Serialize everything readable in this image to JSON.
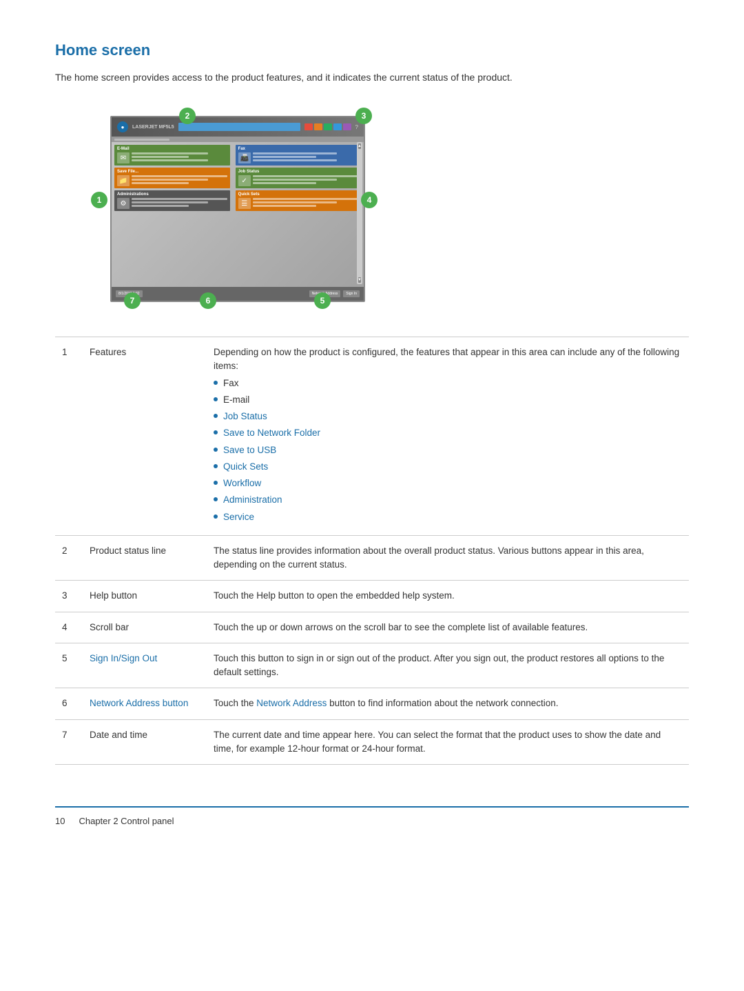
{
  "page": {
    "title": "Home screen",
    "intro": "The home screen provides access to the product features, and it indicates the current status of the product."
  },
  "callouts": {
    "labels": [
      "1",
      "2",
      "3",
      "4",
      "5",
      "6",
      "7"
    ]
  },
  "table": {
    "rows": [
      {
        "num": "1",
        "label": "Features",
        "desc": "Depending on how the product is configured, the features that appear in this area can include any of the following items:",
        "hasList": true,
        "listItems": [
          {
            "text": "Fax",
            "isLink": false
          },
          {
            "text": "E-mail",
            "isLink": false
          },
          {
            "text": "Job Status",
            "isLink": false
          },
          {
            "text": "Save to Network Folder",
            "isLink": false
          },
          {
            "text": "Save to USB",
            "isLink": false
          },
          {
            "text": "Quick Sets",
            "isLink": false
          },
          {
            "text": "Workflow",
            "isLink": false
          },
          {
            "text": "Administration",
            "isLink": false
          },
          {
            "text": "Service",
            "isLink": false
          }
        ]
      },
      {
        "num": "2",
        "label": "Product status line",
        "desc": "The status line provides information about the overall product status. Various buttons appear in this area, depending on the current status.",
        "hasList": false
      },
      {
        "num": "3",
        "label": "Help button",
        "desc": "Touch the Help button to open the embedded help system.",
        "hasList": false
      },
      {
        "num": "4",
        "label": "Scroll bar",
        "desc": "Touch the up or down arrows on the scroll bar to see the complete list of available features.",
        "hasList": false
      },
      {
        "num": "5",
        "label": "Sign In/Sign Out",
        "labelIsLink": true,
        "desc": "Touch this button to sign in or sign out of the product. After you sign out, the product restores all options to the default settings.",
        "hasList": false
      },
      {
        "num": "6",
        "label": "Network Address button",
        "labelIsLink": true,
        "desc_prefix": "Touch the ",
        "desc_link": "Network Address",
        "desc_suffix": " button to find information about the network connection.",
        "hasList": false
      },
      {
        "num": "7",
        "label": "Date and time",
        "desc": "The current date and time appear here. You can select the format that the product uses to show the date and time, for example 12-hour format or 24-hour format.",
        "hasList": false
      }
    ]
  },
  "footer": {
    "pageNum": "10",
    "chapter": "Chapter 2  Control panel"
  }
}
